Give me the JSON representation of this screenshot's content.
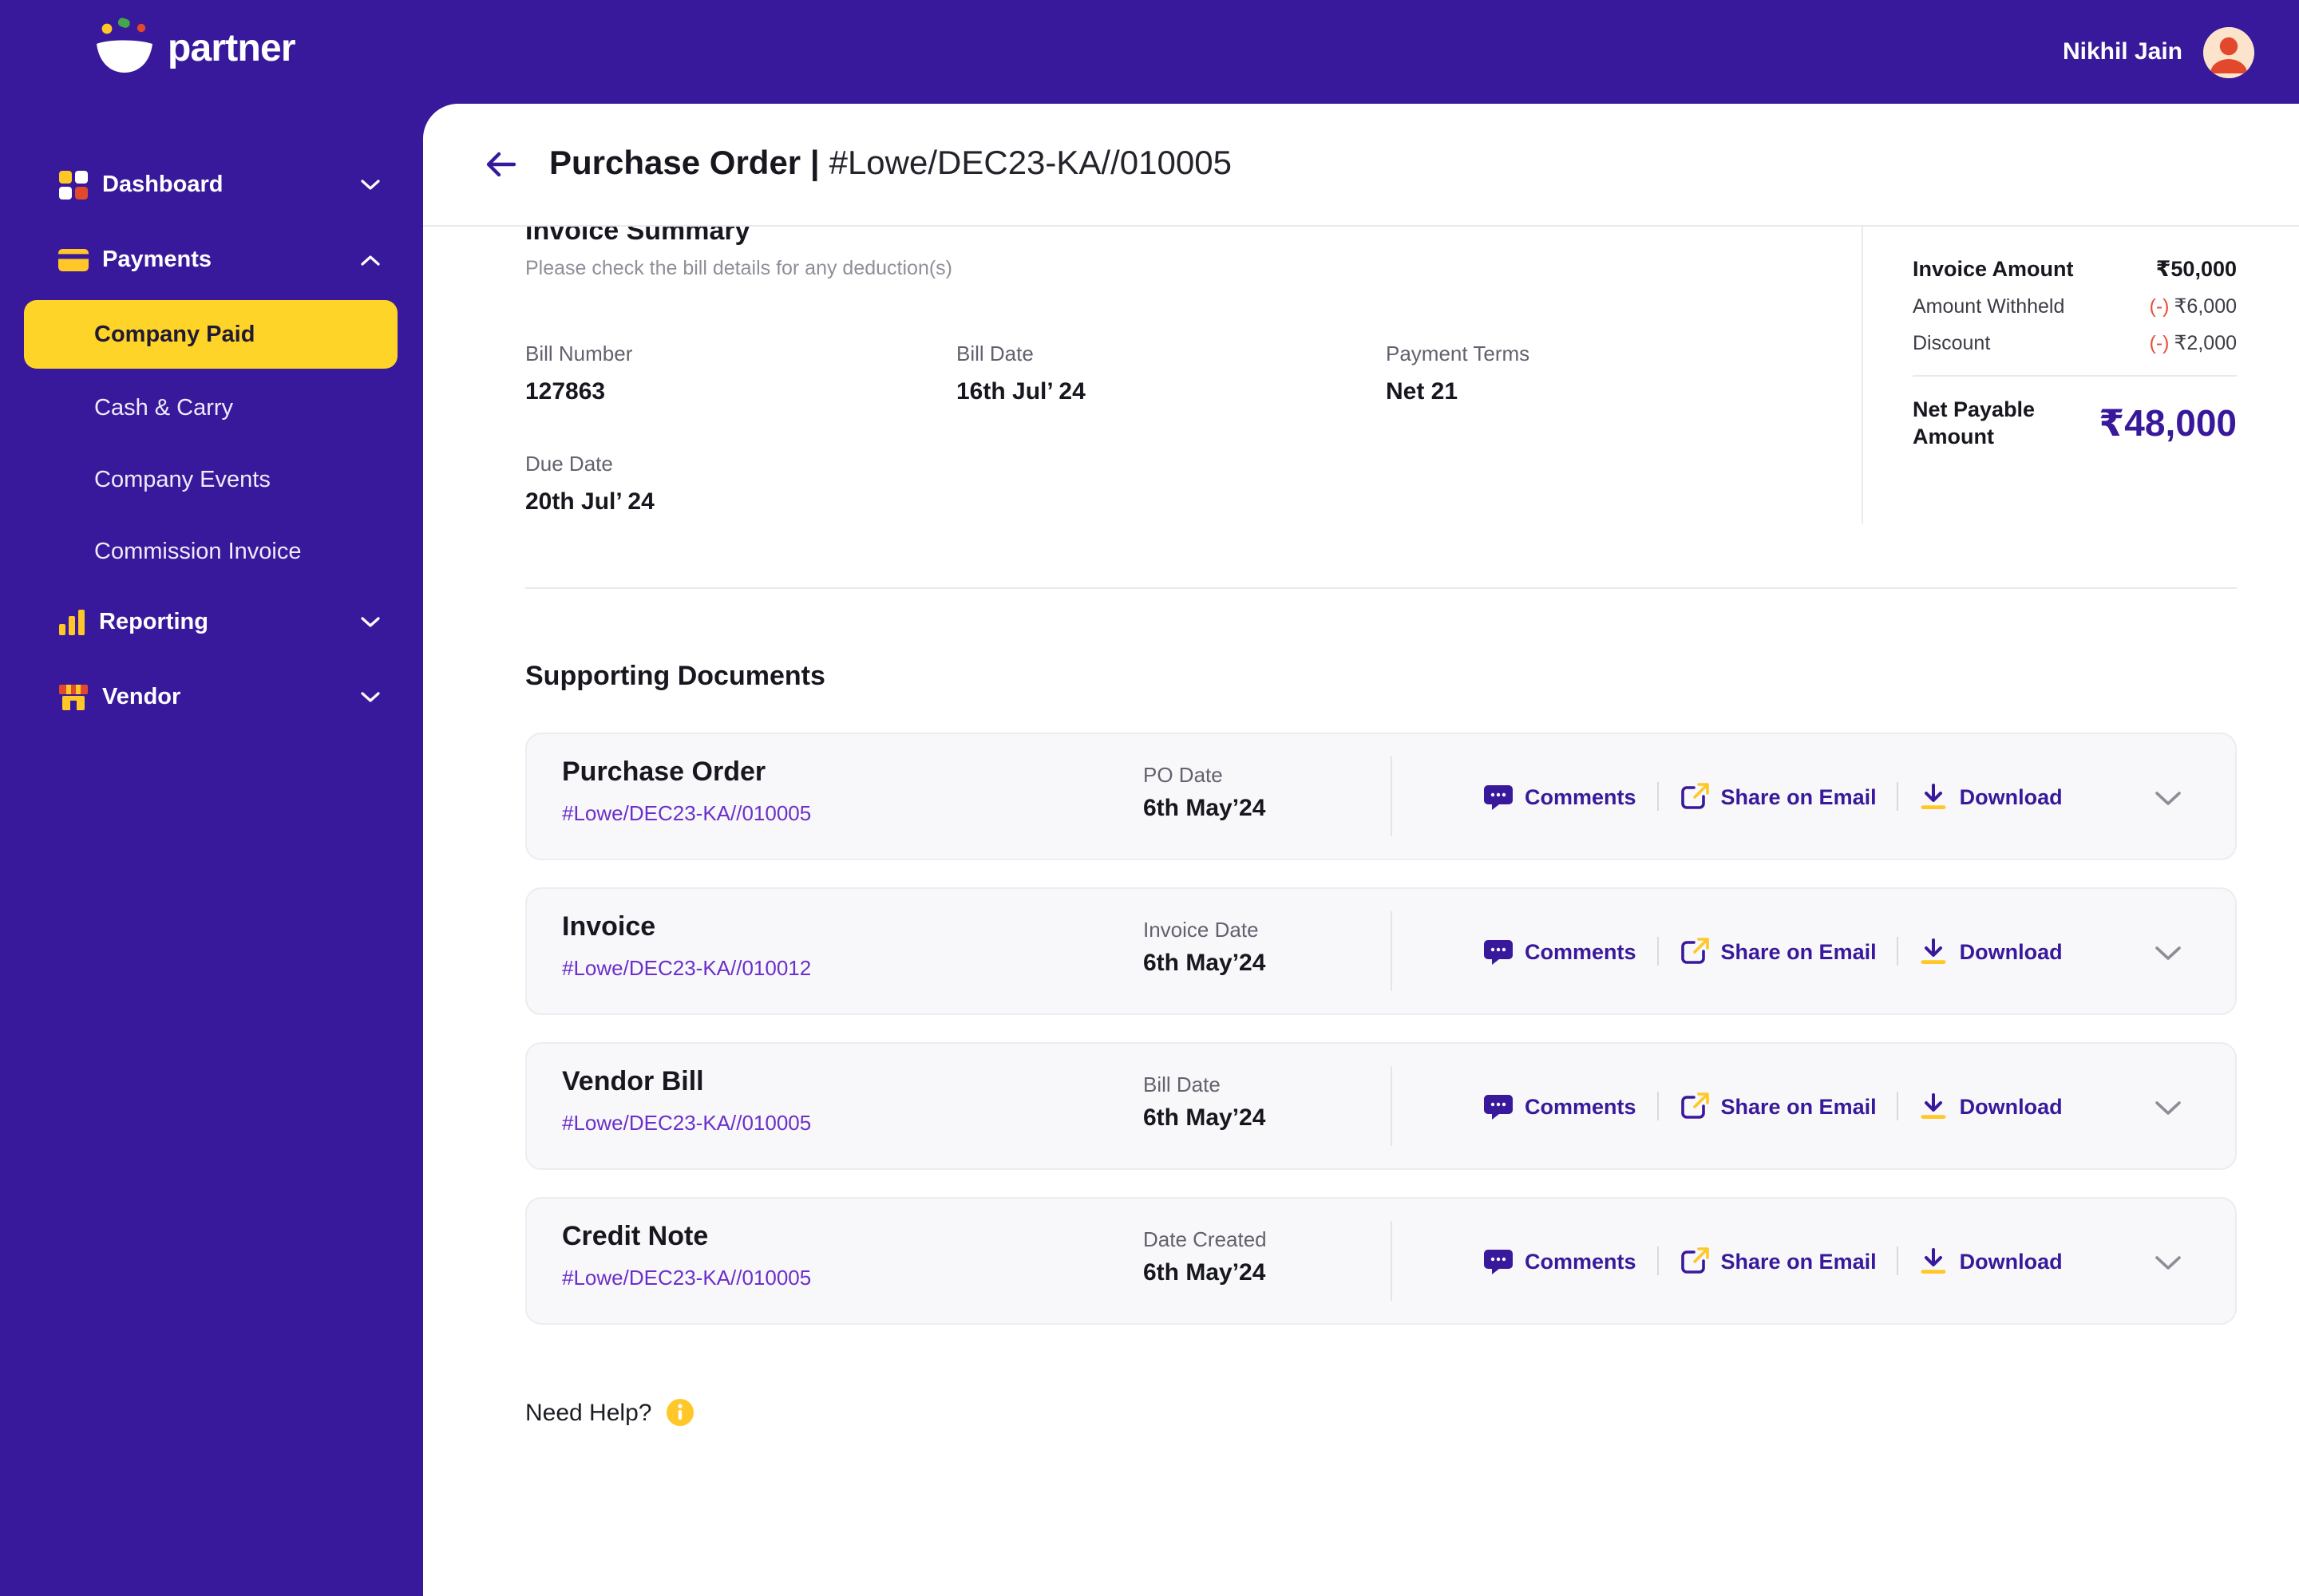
{
  "topbar": {
    "logo_text": "partner",
    "user_name": "Nikhil Jain"
  },
  "sidebar": {
    "items": [
      {
        "label": "Dashboard"
      },
      {
        "label": "Payments"
      },
      {
        "label": "Reporting"
      },
      {
        "label": "Vendor"
      }
    ],
    "payments_submenu": [
      {
        "label": "Company Paid",
        "selected": true
      },
      {
        "label": "Cash & Carry",
        "selected": false
      },
      {
        "label": "Company Events",
        "selected": false
      },
      {
        "label": "Commission Invoice",
        "selected": false
      }
    ]
  },
  "page_header": {
    "title_bold": "Purchase Order |",
    "title_number": "#Lowe/DEC23-KA//010005"
  },
  "invoice_summary": {
    "title": "Invoice Summary",
    "subtitle": "Please check the bill details for any deduction(s)",
    "fields": [
      {
        "label": "Bill Number",
        "value": "127863"
      },
      {
        "label": "Bill Date",
        "value": "16th Jul’ 24"
      },
      {
        "label": "Payment Terms",
        "value": "Net 21"
      },
      {
        "label": "Due Date",
        "value": "20th Jul’ 24"
      }
    ],
    "amount_rows": [
      {
        "label": "Invoice Amount",
        "sign": "",
        "value": "₹50,000"
      },
      {
        "label": "Amount Withheld",
        "sign": "(-)",
        "value": "₹6,000"
      },
      {
        "label": "Discount",
        "sign": "(-)",
        "value": "₹2,000"
      }
    ],
    "net_payable_label": "Net Payable Amount",
    "net_payable_value": "₹48,000"
  },
  "supporting_documents": {
    "title": "Supporting Documents",
    "actions": {
      "comments": "Comments",
      "share": "Share on Email",
      "download": "Download"
    },
    "cards": [
      {
        "title": "Purchase Order",
        "number": "#Lowe/DEC23-KA//010005",
        "date_label": "PO Date",
        "date_value": "6th May’24"
      },
      {
        "title": "Invoice",
        "number": "#Lowe/DEC23-KA//010012",
        "date_label": "Invoice Date",
        "date_value": "6th May’24"
      },
      {
        "title": "Vendor Bill",
        "number": "#Lowe/DEC23-KA//010005",
        "date_label": "Bill Date",
        "date_value": "6th May’24"
      },
      {
        "title": "Credit Note",
        "number": "#Lowe/DEC23-KA//010005",
        "date_label": "Date Created",
        "date_value": "6th May’24"
      }
    ]
  },
  "footer": {
    "need_help_label": "Need Help?"
  },
  "colors": {
    "brand_purple": "#39199B",
    "brand_yellow": "#FFD429",
    "link_purple": "#6B30C9",
    "negative_red": "#E8503A"
  }
}
